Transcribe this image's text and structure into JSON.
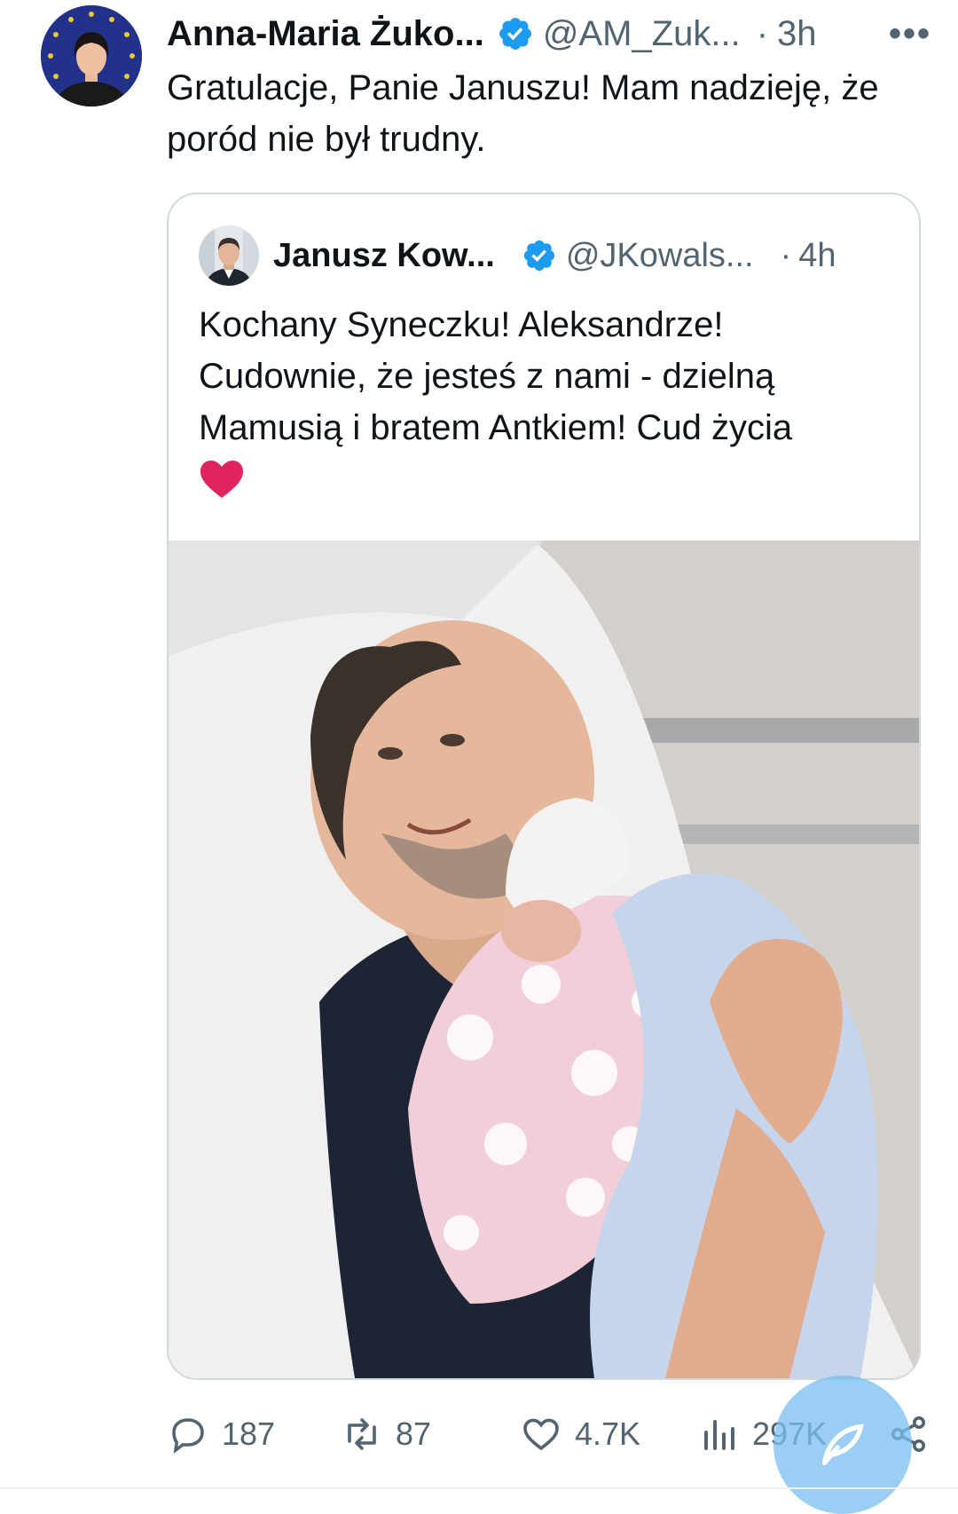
{
  "post": {
    "author_name": "Anna-Maria Żuko...",
    "author_handle": "@AM_Zuk...",
    "separator": "·",
    "time": "3h",
    "more_label": "•••",
    "text": "Gratulacje, Panie Januszu! Mam nadzieję, że poród nie był trudny."
  },
  "quoted": {
    "author_name": "Janusz Kow...",
    "author_handle": "@JKowals...",
    "separator": "·",
    "time": "4h",
    "text_line1": "Kochany Syneczku! Aleksandrze!",
    "text_line2": "Cudownie, że jesteś z nami - dzielną",
    "text_line3": "Mamusią i bratem Antkiem! Cud życia",
    "emoji": "red-heart"
  },
  "actions": {
    "replies": "187",
    "reposts": "87",
    "likes": "4.7K",
    "views": "297K"
  },
  "colors": {
    "verified_blue": "#1d9bf0",
    "secondary_text": "#536471",
    "border": "#cfd9de",
    "heart_red": "#e0245e",
    "fab_blue": "#78bef0"
  },
  "icons": [
    "verified-badge-icon",
    "more-icon",
    "reply-icon",
    "repost-icon",
    "like-icon",
    "views-icon",
    "share-icon",
    "compose-icon",
    "heart-emoji-icon"
  ]
}
